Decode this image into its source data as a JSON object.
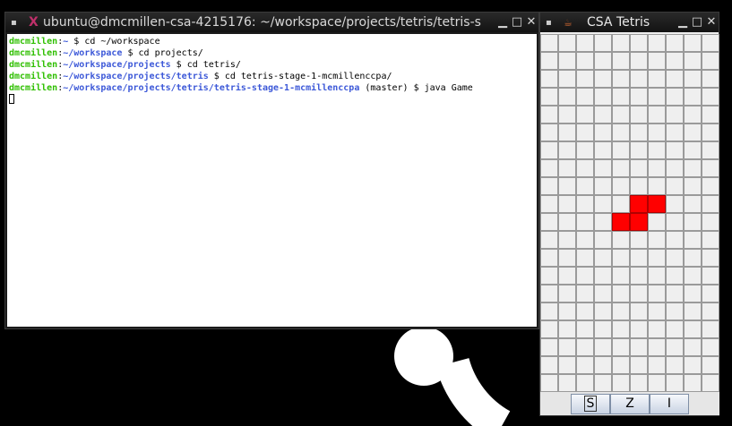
{
  "terminal": {
    "title": "ubuntu@dmcmillen-csa-4215176: ~/workspace/projects/tetris/tetris-s",
    "lines": [
      {
        "user": "dmcmillen",
        "path": "~",
        "branch": "",
        "command": "cd ~/workspace"
      },
      {
        "user": "dmcmillen",
        "path": "~/workspace",
        "branch": "",
        "command": "cd projects/"
      },
      {
        "user": "dmcmillen",
        "path": "~/workspace/projects",
        "branch": "",
        "command": "cd tetris/"
      },
      {
        "user": "dmcmillen",
        "path": "~/workspace/projects/tetris",
        "branch": "",
        "command": "cd tetris-stage-1-mcmillenccpa/"
      },
      {
        "user": "dmcmillen",
        "path": "~/workspace/projects/tetris/tetris-stage-1-mcmillenccpa",
        "branch": "(master)",
        "command": "java Game"
      }
    ]
  },
  "tetris": {
    "title": "CSA Tetris",
    "columns": 10,
    "rows": 20,
    "filled_cells": [
      [
        5,
        9
      ],
      [
        6,
        9
      ],
      [
        4,
        10
      ],
      [
        5,
        10
      ]
    ],
    "cell_color": "#ff0000",
    "grid_color": "#9a9a9a",
    "buttons": [
      {
        "label": "S",
        "focused": true
      },
      {
        "label": "Z",
        "focused": false
      },
      {
        "label": "I",
        "focused": false
      }
    ]
  },
  "colors": {
    "user": "#2fbf00",
    "path": "#3c58d8",
    "titlebar": "#1e1e1e"
  },
  "icons": {
    "window_menu": "window-menu-icon",
    "terminal_app": "terminal-x-icon",
    "java_app": "java-app-icon",
    "minimize": "minimize-icon",
    "maximize": "maximize-icon",
    "close": "close-icon"
  }
}
